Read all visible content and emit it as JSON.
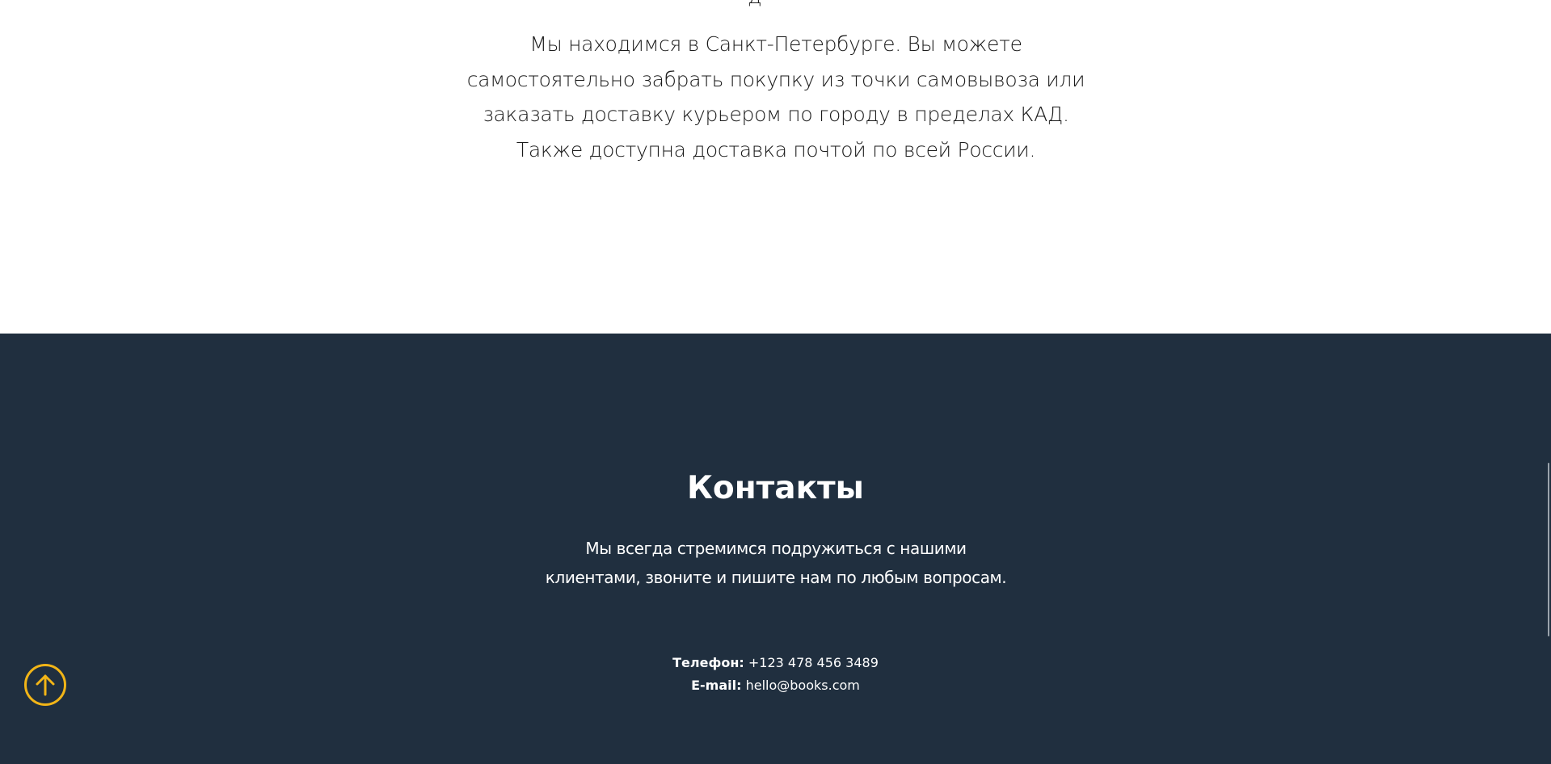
{
  "top_section": {
    "cut_char": "д",
    "delivery_lines": [
      "Мы находимся в Санкт-Петербурге. Вы можете",
      "самостоятельно забрать покупку из точки самовывоза или",
      "заказать доставку курьером по городу в пределах КАД.",
      "Также доступна доставка почтой по всей России."
    ]
  },
  "footer": {
    "title": "Контакты",
    "description_lines": [
      "Мы всегда стремимся подружиться с нашими",
      "клиентами, звоните и пишите нам по любым вопросам."
    ],
    "phone_label": "Телефон:",
    "phone_value": "+123 478 456 3489",
    "email_label": "E-mail:",
    "email_value": "hello@books.com",
    "background_color": "#202f3f"
  },
  "scroll_top_button": {
    "icon": "arrow-up-circle-icon",
    "color": "#f2b517"
  }
}
